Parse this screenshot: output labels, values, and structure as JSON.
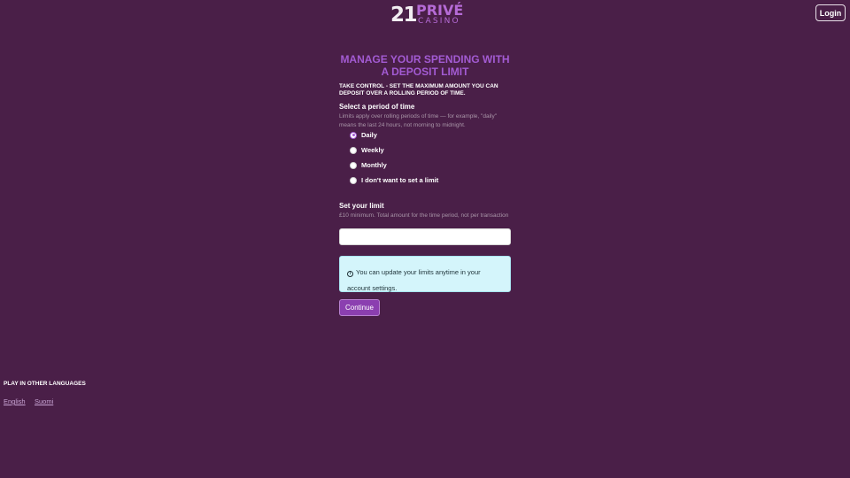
{
  "header": {
    "logo": {
      "number": "21",
      "brand": "PRIVÉ",
      "sub": "CASINO"
    },
    "login_label": "Login"
  },
  "main": {
    "title": "MANAGE YOUR SPENDING WITH A DEPOSIT LIMIT",
    "subtitle": "TAKE CONTROL - SET THE MAXIMUM AMOUNT YOU CAN DEPOSIT OVER A ROLLING PERIOD OF TIME.",
    "period": {
      "heading": "Select a period of time",
      "help": "Limits apply over rolling periods of time — for example, \"daily\" means the last 24 hours, not morning to midnight.",
      "options": [
        {
          "label": "Daily",
          "checked": true
        },
        {
          "label": "Weekly",
          "checked": false
        },
        {
          "label": "Monthly",
          "checked": false
        },
        {
          "label": "I don't want to set a limit",
          "checked": false
        }
      ]
    },
    "limit": {
      "heading": "Set your limit",
      "help": "£10 minimum. Total amount for the time period, not per transaction",
      "value": "",
      "placeholder": ""
    },
    "info": {
      "icon": "info-icon",
      "text": "You can update your limits anytime in your account settings."
    },
    "continue_label": "Continue"
  },
  "footer": {
    "languages_heading": "PLAY IN OTHER LANGUAGES",
    "languages": [
      "English",
      "Suomi"
    ]
  },
  "colors": {
    "background": "#4a1f48",
    "accent": "#a35bd3",
    "button": "#8b3fb0",
    "info_bg": "#d4f5fb"
  }
}
